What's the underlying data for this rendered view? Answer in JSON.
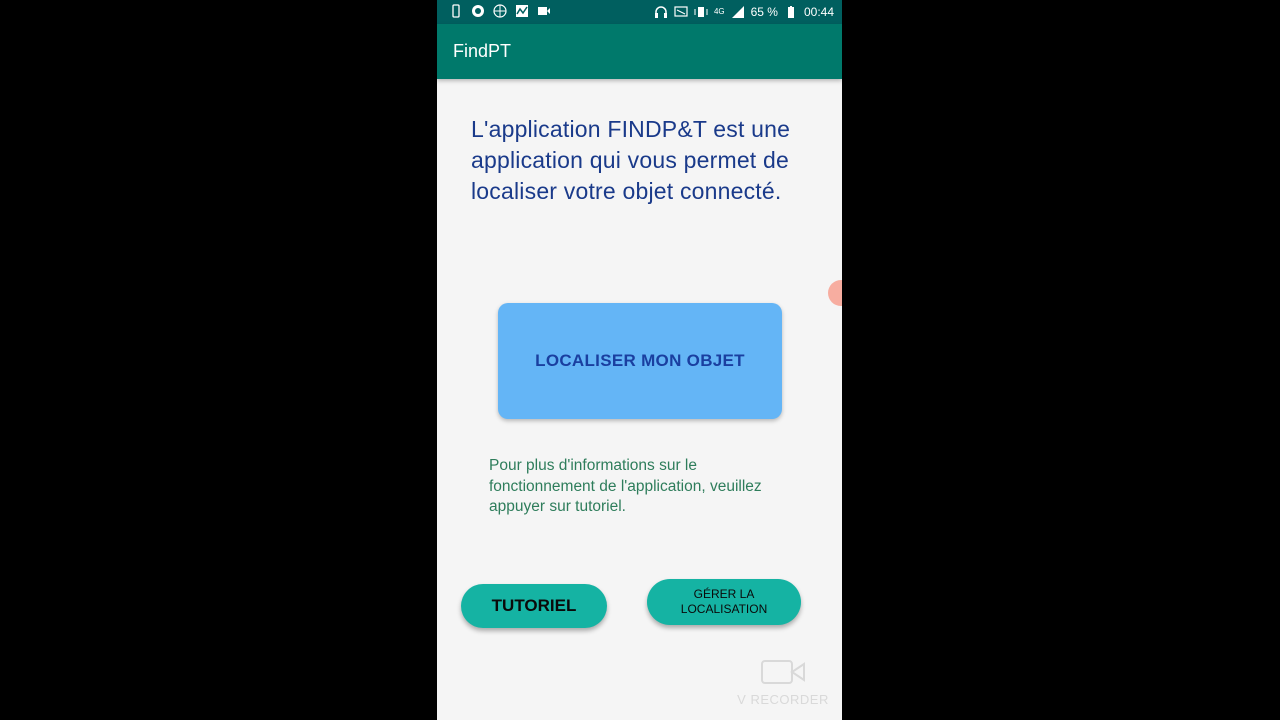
{
  "status_bar": {
    "battery_percent": "65 %",
    "time": "00:44",
    "network": "4G"
  },
  "app_bar": {
    "title": "FindPT"
  },
  "main": {
    "intro_text": "L'application FINDP&T est une application qui vous permet de localiser votre objet connecté.",
    "locate_button_label": "LOCALISER MON OBJET",
    "info_text": "Pour plus d'informations sur le fonctionnement de l'application, veuillez appuyer sur tutoriel.",
    "tutorial_button_label": "TUTORIEL",
    "manage_location_button_label": "GÉRER LA LOCALISATION"
  },
  "watermark": {
    "text": "V RECORDER"
  },
  "colors": {
    "status_bar": "#005f5f",
    "app_bar": "#00796b",
    "locate_button": "#64b5f6",
    "teal_buttons": "#15b3a3",
    "intro_text": "#1a3a8a",
    "info_text": "#2e7d5b"
  }
}
